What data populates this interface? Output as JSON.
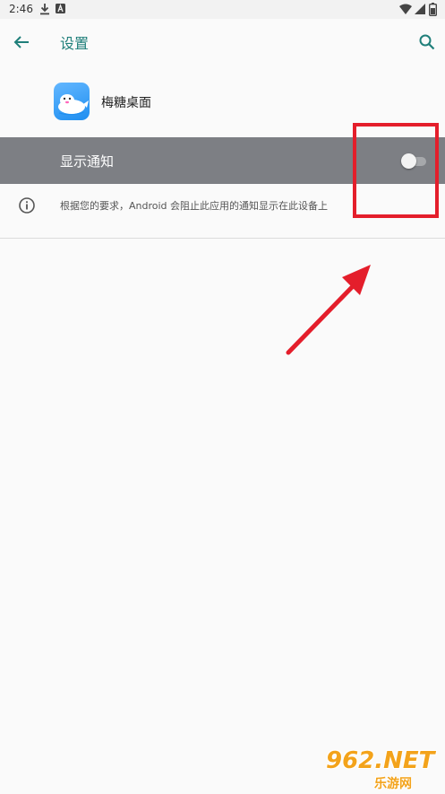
{
  "status_bar": {
    "time": "2:46",
    "icons": [
      "download-icon",
      "a-notification-icon",
      "wifi-icon",
      "signal-icon",
      "battery-icon"
    ]
  },
  "app_bar": {
    "title": "设置",
    "back_icon": "arrow-back-icon",
    "search_icon": "search-icon"
  },
  "app": {
    "name": "梅糖桌面",
    "icon": "app-icon"
  },
  "notification_setting": {
    "label": "显示通知",
    "enabled": false
  },
  "info": {
    "text": "根据您的要求，Android 会阻止此应用的通知显示在此设备上"
  },
  "watermark": {
    "main": "962.NET",
    "sub": "乐游网"
  },
  "colors": {
    "accent": "#1f7f7a",
    "row_highlight": "#7d7f84",
    "annotation_red": "#e41e2b",
    "watermark": "#f3a31b"
  }
}
